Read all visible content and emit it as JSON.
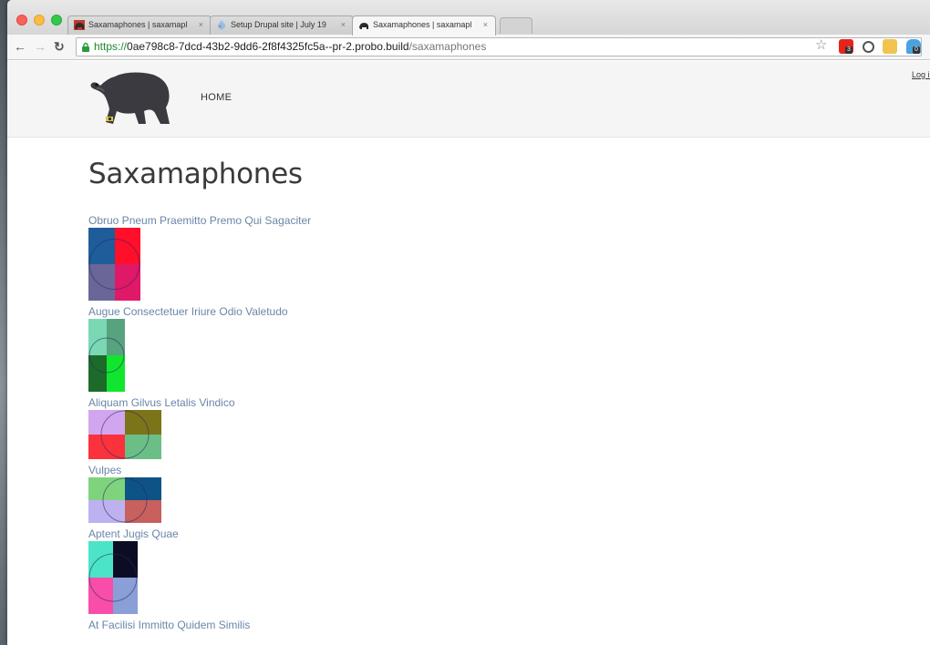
{
  "browser": {
    "tabs": [
      {
        "title": "Saxamaphones | saxamapl",
        "active": false,
        "favicon": "bear-icon"
      },
      {
        "title": "Setup Drupal site | July 19",
        "active": false,
        "favicon": "drupal-icon"
      },
      {
        "title": "Saxamaphones | saxamapl",
        "active": true,
        "favicon": "bear-icon"
      }
    ],
    "tab_close_glyph": "×",
    "url": {
      "scheme": "https://",
      "host": "0ae798c8-7dcd-43b2-9dd6-2f8f4325fc5a--pr-2.probo.build",
      "path": "/saxamaphones"
    },
    "extension_badges": [
      "3",
      "0"
    ]
  },
  "site": {
    "nav_home": "HOME",
    "login": "Log in",
    "page_title": "Saxamaphones"
  },
  "items": [
    {
      "title": "Obruo Pneum Praemitto Premo Qui Sagaciter",
      "colors": [
        "#1e5d9a",
        "#ff0f2a",
        "#6a6798",
        "#df1868"
      ]
    },
    {
      "title": "Augue Consectetuer Iriure Odio Valetudo",
      "colors": [
        "#7ad8b4",
        "#57a37e",
        "#1d6b2a",
        "#11e62e"
      ]
    },
    {
      "title": "Aliquam Gilvus Letalis Vindico",
      "colors": [
        "#d2a6ee",
        "#7c7418",
        "#fb313c",
        "#6bbf86"
      ]
    },
    {
      "title": "Vulpes",
      "colors": [
        "#7fd37d",
        "#0e5386",
        "#bdb2ef",
        "#c8605e"
      ]
    },
    {
      "title": "Aptent Jugis Quae",
      "colors": [
        "#4be4c8",
        "#0c0d24",
        "#f84eaa",
        "#8a9ed8"
      ]
    },
    {
      "title": "At Facilisi Immitto Quidem Similis",
      "colors": [
        "#cccccc",
        "#cccccc",
        "#cccccc",
        "#cccccc"
      ]
    }
  ]
}
